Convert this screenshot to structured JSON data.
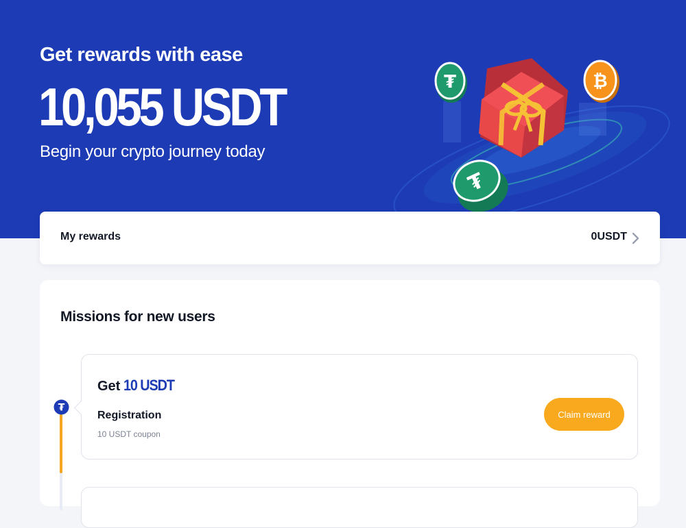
{
  "hero": {
    "subtitle": "Get rewards with ease",
    "amount": "10,055 USDT",
    "tagline": "Begin your crypto journey today",
    "art_icons": [
      "tether-coin-icon",
      "gift-box-icon",
      "bitcoin-coin-icon",
      "tether-coin-icon"
    ]
  },
  "rewards": {
    "label": "My rewards",
    "value": "0USDT",
    "icon": "chevron-right-icon"
  },
  "missions": {
    "title": "Missions for new users",
    "items": [
      {
        "get_word": "Get",
        "amount": "10 USDT",
        "name": "Registration",
        "description": "10 USDT coupon",
        "button": "Claim reward",
        "icon": "tether-icon"
      }
    ]
  },
  "colors": {
    "brand_blue": "#1d3bb5",
    "accent_orange": "#f8a91e",
    "tether_green": "#1f9a6d",
    "bitcoin_orange": "#f7931a",
    "gift_red": "#e84848"
  }
}
